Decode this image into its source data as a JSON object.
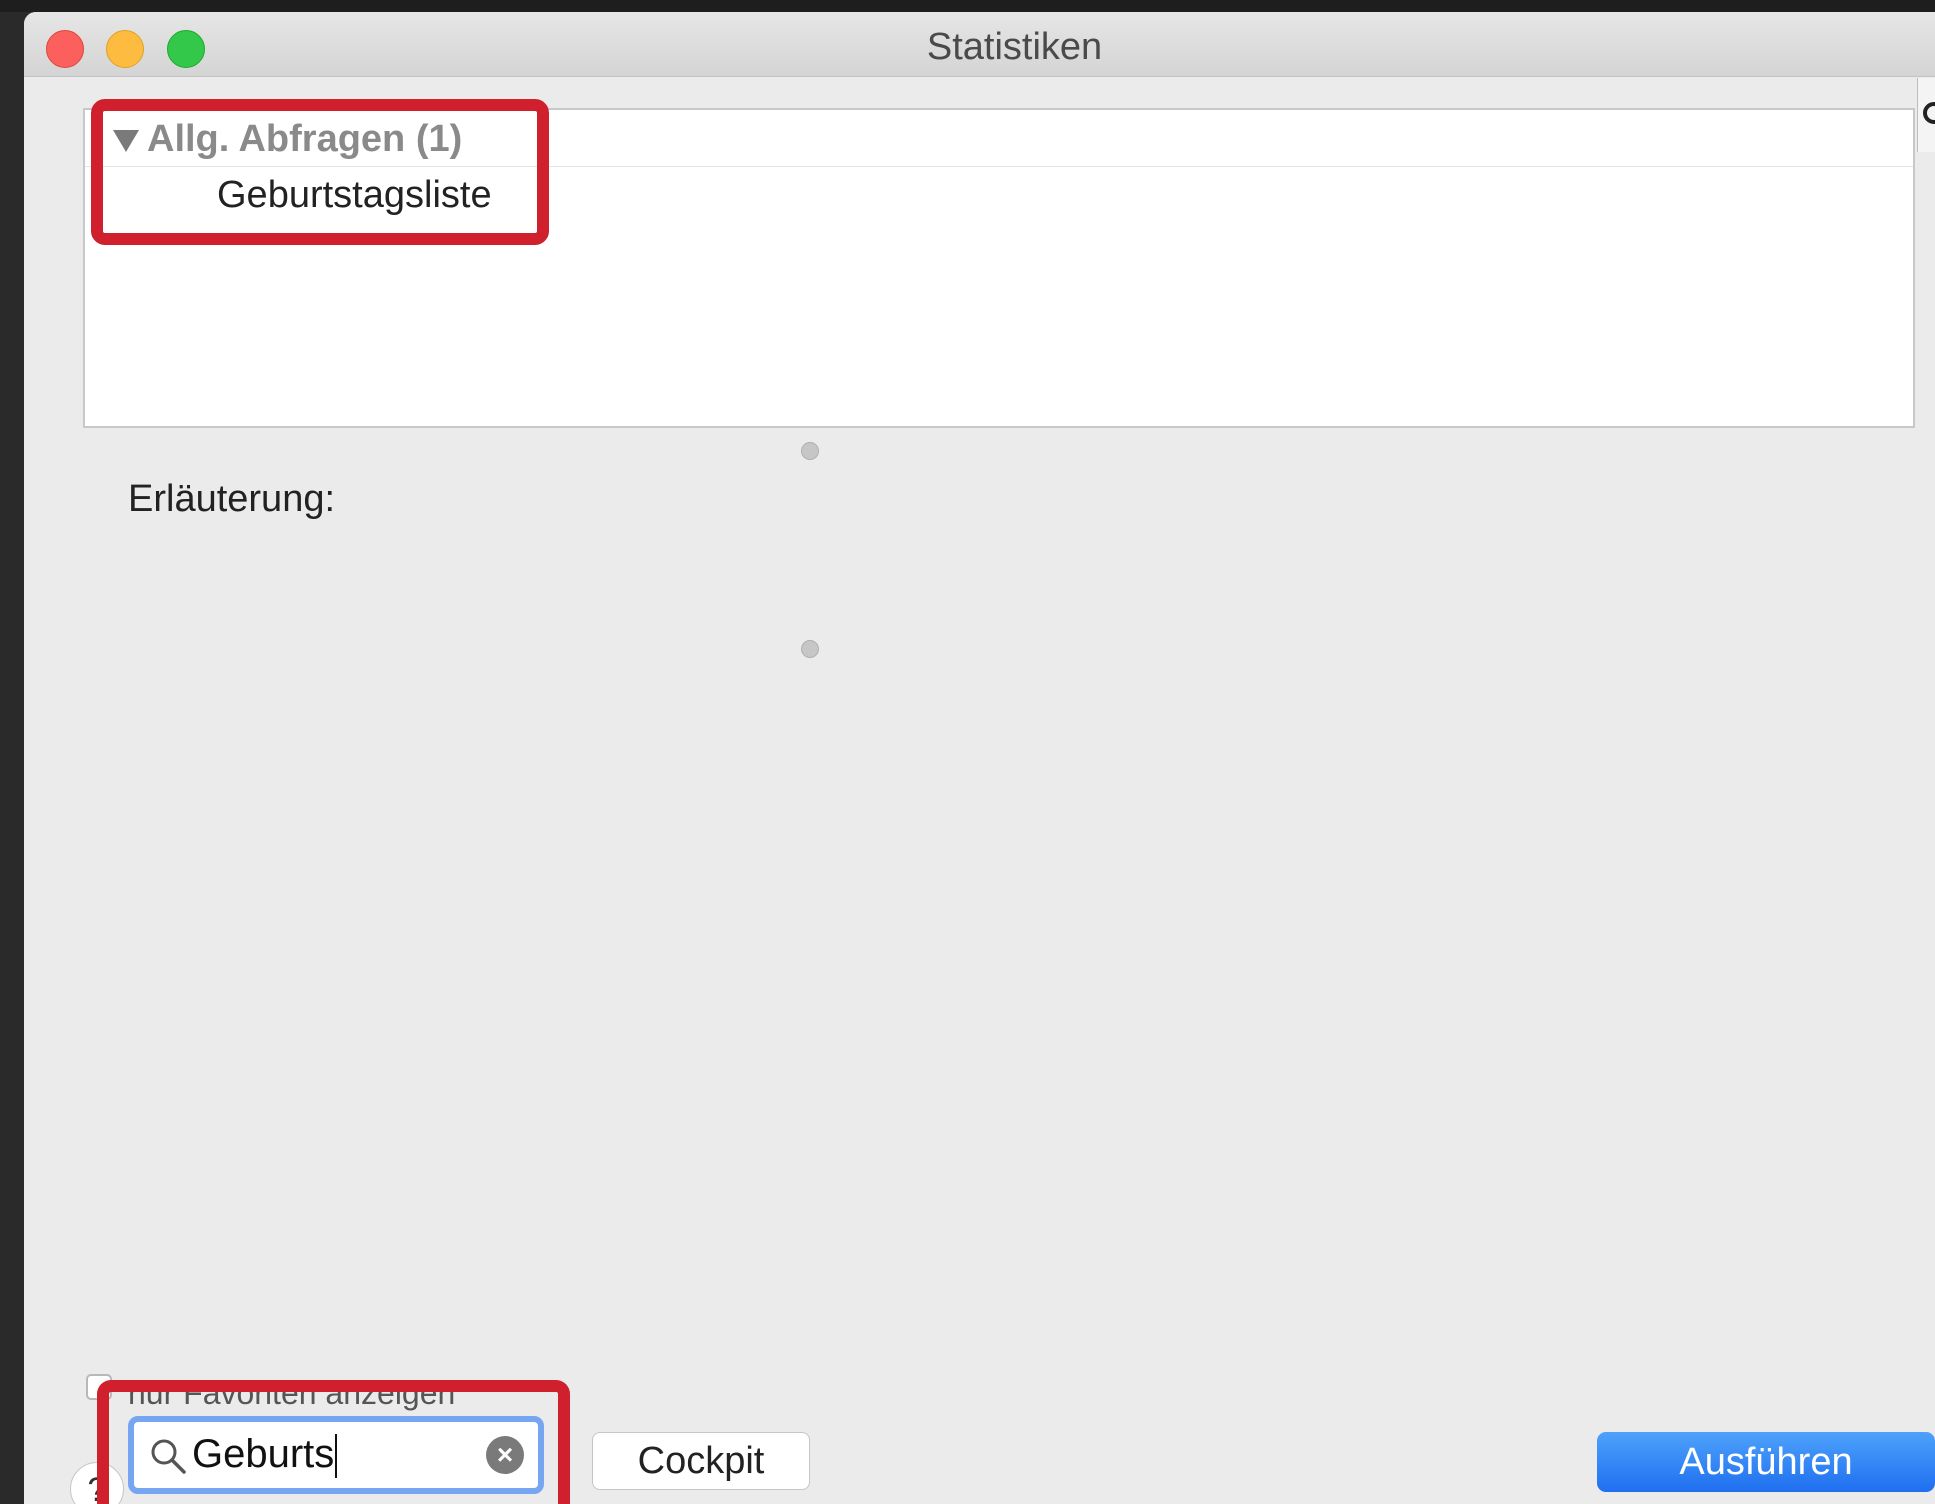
{
  "window": {
    "title": "Statistiken"
  },
  "outline": {
    "group_label": "Allg. Abfragen (1)",
    "items": [
      {
        "label": "Geburtstagsliste"
      }
    ]
  },
  "details": {
    "label": "Erläuterung:"
  },
  "favorites": {
    "label": "nur Favoriten anzeigen",
    "checked": false
  },
  "search": {
    "value": "Geburts"
  },
  "buttons": {
    "cockpit": "Cockpit",
    "run": "Ausführen",
    "help": "?"
  },
  "icons": {
    "search": "search-icon",
    "clear": "clear-search-icon",
    "disclosure": "disclosure-triangle-down-icon"
  },
  "colors": {
    "annotation": "#d0202d",
    "focus_ring": "#76a6f1",
    "primary_button": "#1f6ff0"
  }
}
